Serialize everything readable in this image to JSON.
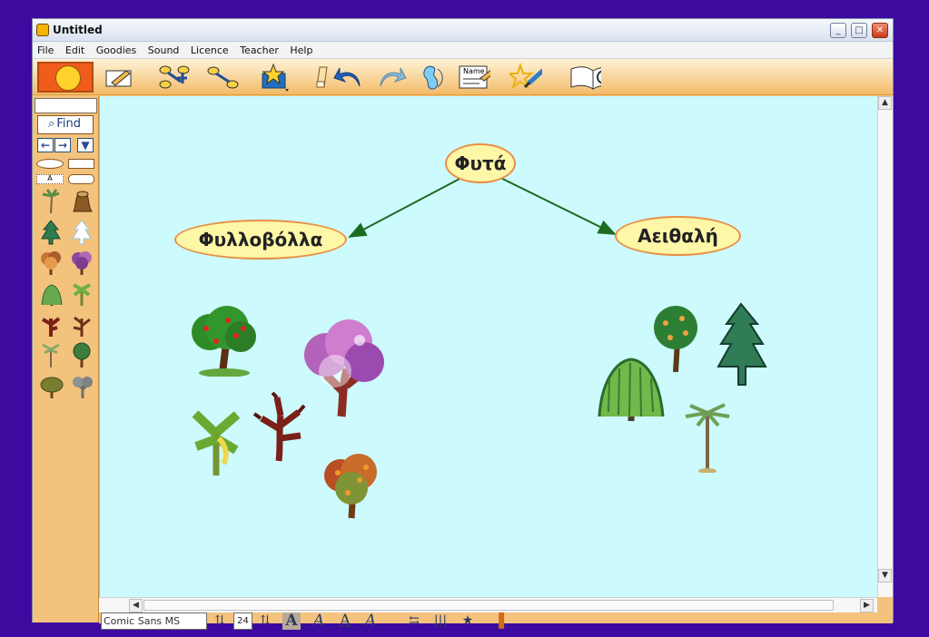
{
  "window": {
    "title": "Untitled"
  },
  "menu": [
    "File",
    "Edit",
    "Goodies",
    "Sound",
    "Licence",
    "Teacher",
    "Help"
  ],
  "toolbar": {
    "icons": [
      "pencil-note-icon",
      "add-node-icon",
      "link-icon",
      "box-star-icon",
      "eraser-icon",
      "undo-icon",
      "redo-icon",
      "listen-icon",
      "name-tag-icon",
      "magic-brush-icon",
      "book-search-icon"
    ]
  },
  "sidebar": {
    "find_label": "Find",
    "tools": [
      "back-arrow-icon",
      "forward-arrow-icon",
      "down-arrow-icon"
    ]
  },
  "concept_map": {
    "root": "Φυτά",
    "children": [
      "Φυλλοβόλλα",
      "Αειθαλή"
    ],
    "colors": {
      "node_fill": "#fff7a8",
      "node_border": "#e99045",
      "arrow": "#1d6b21",
      "canvas": "#ccfafd"
    }
  },
  "bottom_toolbar": {
    "font": "Comic Sans MS",
    "size": "24"
  }
}
